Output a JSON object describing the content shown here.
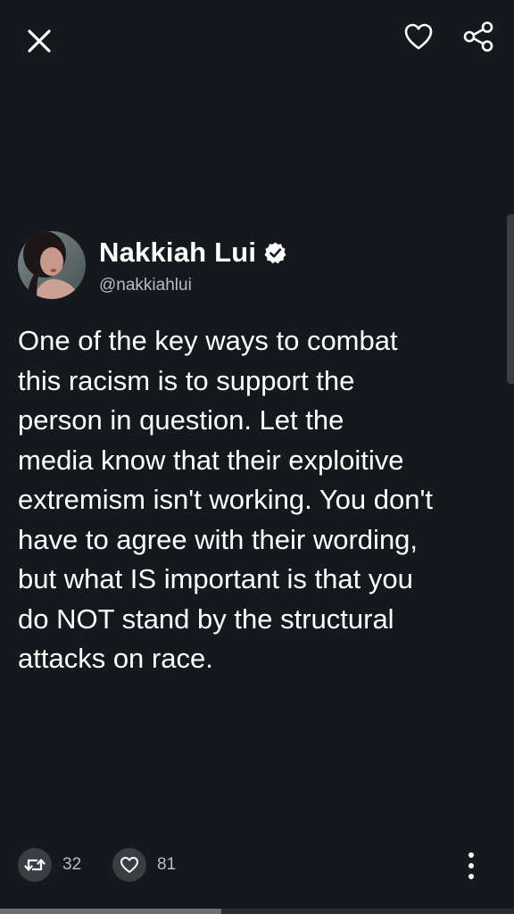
{
  "toolbar": {
    "close_icon": "close-icon",
    "like_icon": "heart-outline-icon",
    "share_icon": "share-icon"
  },
  "tweet": {
    "author_name": "Nakkiah Lui",
    "author_handle": "@nakkiahlui",
    "verified": true,
    "text": "One of the key ways to combat\nthis racism is to support the\nperson in question. Let the\nmedia know that their exploitive\nextremism isn't working. You don't\nhave to agree with their wording,\nbut what IS important is that you\ndo NOT stand by the structural\nattacks on race."
  },
  "actions": {
    "retweet_count": "32",
    "like_count": "81",
    "retweet_icon": "retweet-icon",
    "like_icon": "heart-icon",
    "more_icon": "more-vertical-icon"
  },
  "colors": {
    "background": "#15181c",
    "text_primary": "#ffffff",
    "text_secondary": "#b8bcc2",
    "button_bg": "#3a3d42"
  }
}
